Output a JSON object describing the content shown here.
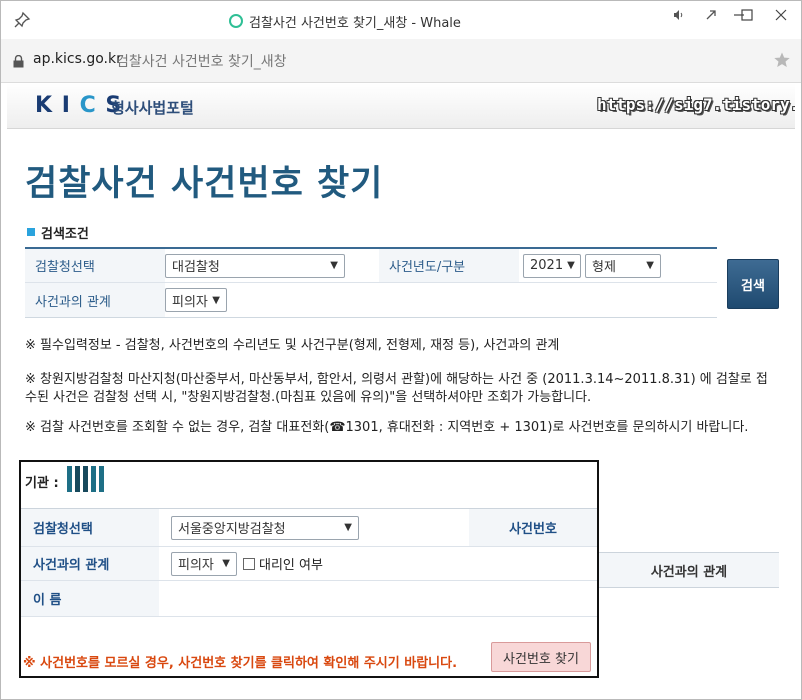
{
  "window": {
    "title": "검찰사건 사건번호 찾기_새창 - Whale",
    "controls": [
      "sound-icon",
      "share-icon",
      "minimize-icon",
      "maximize-icon",
      "close-icon"
    ]
  },
  "address": {
    "host": "ap.kics.go.kr",
    "page_title": "검찰사건 사건번호 찾기_새창"
  },
  "banner": {
    "logo": "KICS",
    "portal_name": "형사사법포털",
    "watermark": "https://sig7.tistory.com"
  },
  "main": {
    "page_title": "검찰사건 사건번호 찾기",
    "section_title": "검색조건",
    "search": {
      "prosecutor_label": "검찰청선택",
      "prosecutor_value": "대검찰청",
      "year_label": "사건년도/구분",
      "year_value": "2021",
      "type_value": "형제",
      "relation_label": "사건과의 관계",
      "relation_value": "피의자",
      "search_button": "검색"
    },
    "notices": [
      "※ 필수입력정보 - 검찰청, 사건번호의 수리년도 및 사건구분(형제, 전형제, 재정 등), 사건과의 관계",
      "※ 창원지방검찰청 마산지청(마산중부서, 마산동부서, 함안서, 의령서 관할)에 해당하는 사건 중 (2011.3.14~2011.8.31) 에 검찰로 접",
      "수된 사건은 검찰청 선택 시, \"창원지방검찰청.(마침표 있음에 유의)\"을 선택하셔야만 조회가 가능합니다.",
      "※ 검찰 사건번호를 조회할 수 없는 경우, 검찰 대표전화(☎1301, 휴대전화 : 지역번호 + 1301)로 사건번호를 문의하시기 바랍니다."
    ]
  },
  "dialog": {
    "org_label": "기관 :",
    "prosecutor_label": "검찰청선택",
    "prosecutor_value": "서울중앙지방검찰청",
    "case_number_label": "사건번호",
    "relation_label": "사건과의 관계",
    "relation_value": "피의자",
    "proxy_label": "대리인 여부",
    "name_label": "이 름",
    "warning": "※ 사건번호를 모르실 경우, 사건번호 찾기를 클릭하여 확인해 주시기 바랍니다.",
    "find_button": "사건번호 찾기"
  },
  "background_table": {
    "column_header": "사건과의 관계"
  },
  "colors": {
    "title_blue": "#215a7f",
    "accent_blue": "#2aa3dd",
    "warning_orange": "#d9480f",
    "button_pink": "#f8d7d7"
  }
}
